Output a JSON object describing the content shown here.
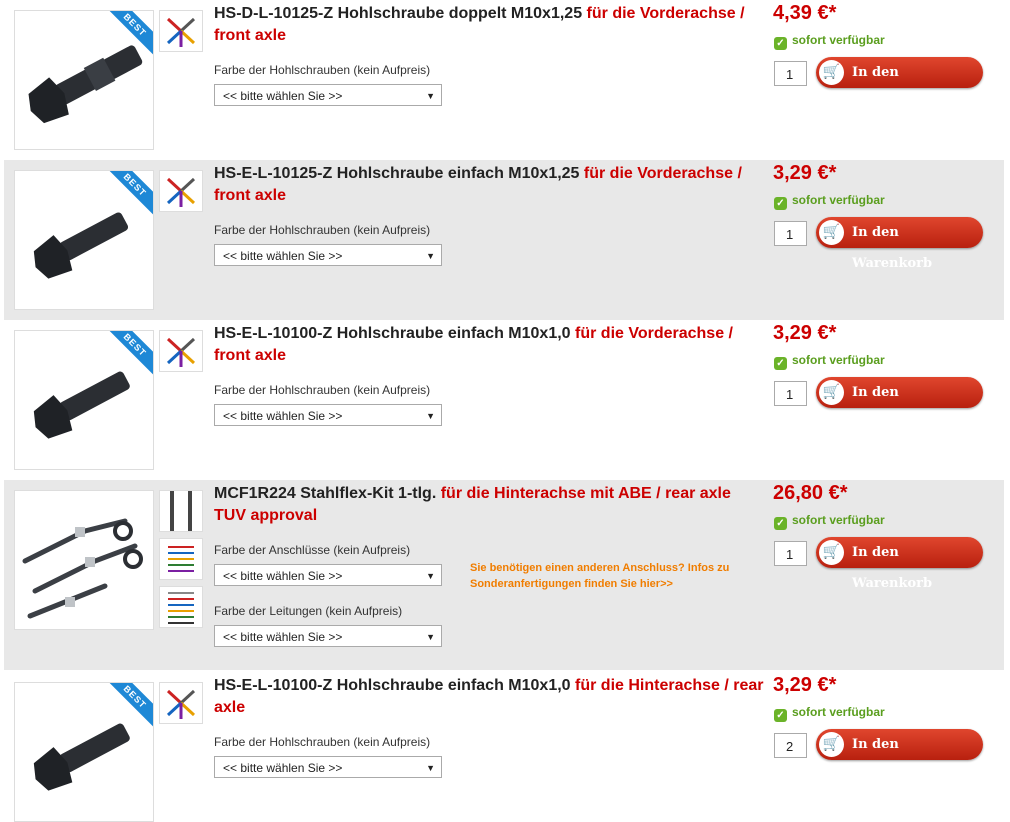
{
  "products": [
    {
      "code": "HS-D-L-10125-Z Hohlschraube doppelt M10x1,25",
      "subtitle": "für die Vorderachse / front axle",
      "badge": "BEST",
      "option_label": "Farbe der Hohlschrauben (kein Aufpreis)",
      "select_value": "<< bitte wählen Sie >>",
      "price": "4,39 €*",
      "availability": "sofort verfügbar",
      "quantity": "1",
      "cart_label": "In den Warenkorb"
    },
    {
      "code": "HS-E-L-10125-Z Hohlschraube einfach M10x1,25",
      "subtitle": "für die Vorderachse / front axle",
      "badge": "BEST",
      "option_label": "Farbe der Hohlschrauben (kein Aufpreis)",
      "select_value": "<< bitte wählen Sie >>",
      "price": "3,29 €*",
      "availability": "sofort verfügbar",
      "quantity": "1",
      "cart_label": "In den Warenkorb"
    },
    {
      "code": "HS-E-L-10100-Z Hohlschraube einfach M10x1,0",
      "subtitle": "für die Vorderachse / front axle",
      "badge": "BEST",
      "option_label": "Farbe der Hohlschrauben (kein Aufpreis)",
      "select_value": "<< bitte wählen Sie >>",
      "price": "3,29 €*",
      "availability": "sofort verfügbar",
      "quantity": "1",
      "cart_label": "In den Warenkorb"
    },
    {
      "code": "MCF1R224 Stahlflex-Kit 1-tlg.",
      "subtitle": "für die Hinterachse mit ABE / rear axle TUV approval",
      "option_label": "Farbe der Anschlüsse (kein Aufpreis)",
      "select_value": "<< bitte wählen Sie >>",
      "option_label_2": "Farbe der Leitungen (kein Aufpreis)",
      "select_value_2": "<< bitte wählen Sie >>",
      "note": "Sie benötigen einen anderen Anschluss? Infos zu Sonderanfertigungen finden Sie hier>>",
      "price": "26,80 €*",
      "availability": "sofort verfügbar",
      "quantity": "1",
      "cart_label": "In den Warenkorb"
    },
    {
      "code": "HS-E-L-10100-Z Hohlschraube einfach M10x1,0",
      "subtitle": "für die Hinterachse / rear axle",
      "badge": "BEST",
      "option_label": "Farbe der Hohlschrauben (kein Aufpreis)",
      "select_value": "<< bitte wählen Sie >>",
      "price": "3,29 €*",
      "availability": "sofort verfügbar",
      "quantity": "2",
      "cart_label": "In den Warenkorb"
    }
  ],
  "colors": {
    "accent": "#cc0000",
    "available": "#5a9e1e",
    "badge": "#1e88d6",
    "note": "#f07d00",
    "row_shade": "#e8e8e8"
  }
}
